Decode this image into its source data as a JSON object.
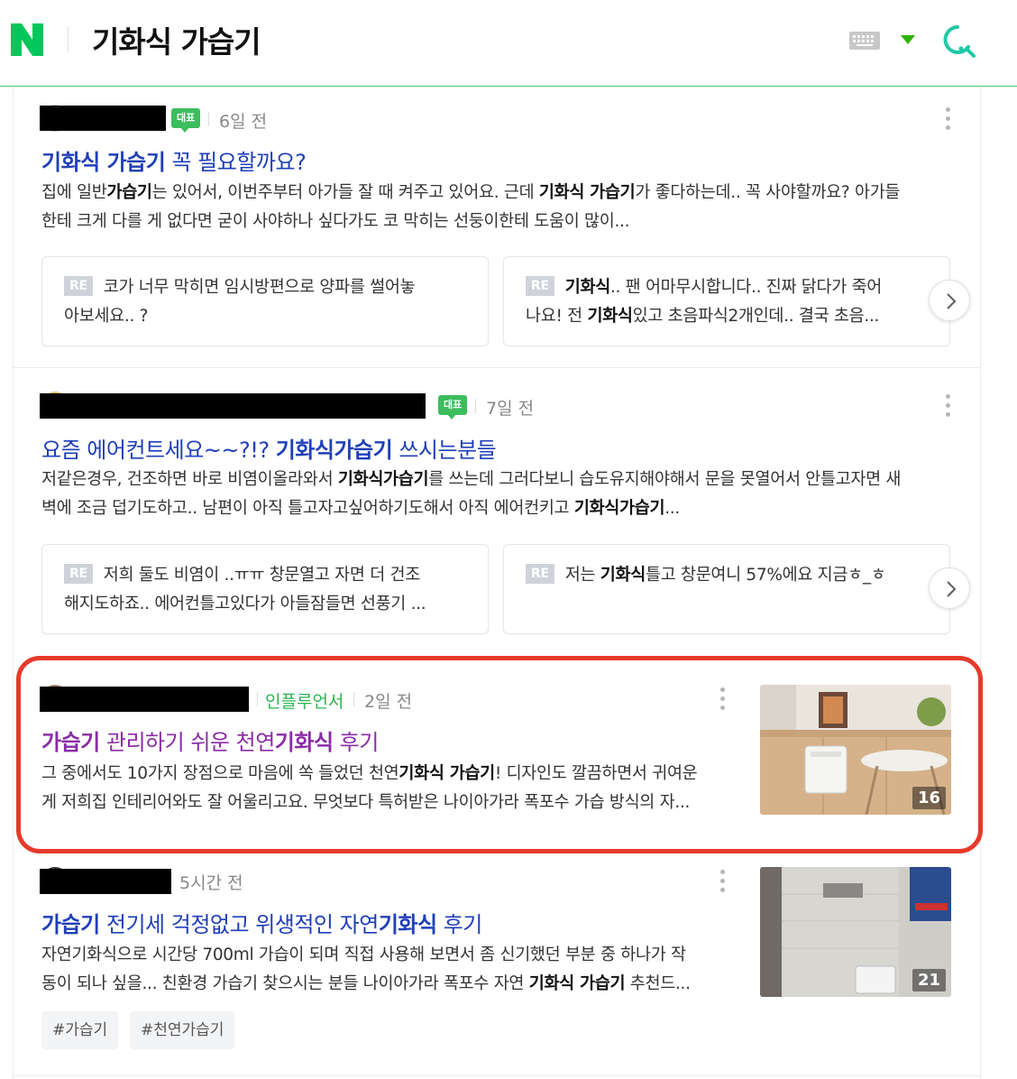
{
  "header": {
    "query": "기화식 가습기",
    "logo_letter": "N",
    "accent_color": "#03c75a",
    "icons": [
      "naver-logo",
      "keyboard-icon",
      "dropdown-arrow-icon",
      "search-icon"
    ]
  },
  "posts": [
    {
      "rep_badge": "대표",
      "time": "6일 전",
      "title_pre": "",
      "title_b1": "기화식 가습기",
      "title_post": " 꼭 필요할까요?",
      "desc_l1_a": "집에 일반",
      "desc_l1_b": "가습기",
      "desc_l1_c": "는 있어서, 이번주부터 아가들 잘 때 켜주고 있어요. 근데 ",
      "desc_l1_d": "기화식 가습기",
      "desc_l1_e": "가 좋다하는데.. 꼭 사야할까요? 아가들",
      "desc_l2": "한테 크게 다를 게 없다면 굳이 사야하나 싶다가도 코 막히는 선둥이한테 도움이 많이...",
      "replies": [
        {
          "re": "RE",
          "pre": "코가 너무 막히면 임시방편으로 양파를 썰어놓",
          "line2": "아보세요.. ?"
        },
        {
          "re": "RE",
          "b1": "기화식",
          "mid": ".. 팬 어마무시합니다.. 진짜 닭다가 죽어",
          "line2_a": "나요! 전 ",
          "line2_b": "기화식",
          "line2_c": "있고 초음파식2개인데.. 결국 초음..."
        }
      ]
    },
    {
      "rep_badge": "대표",
      "time": "7일 전",
      "title_pre": "요즘 에어컨트세요~~?!? ",
      "title_b1": "기화식가습기",
      "title_post": " 쓰시는분들",
      "desc_l1_a": "저같은경우, 건조하면 바로 비염이올라와서 ",
      "desc_l1_b": "기화식가습기",
      "desc_l1_c": "를 쓰는데 그러다보니 습도유지해야해서 문을 못열어서 안틀고자면 새",
      "desc_l2_a": "벽에 조금 덥기도하고.. 남편이 아직 틀고자고싶어하기도해서 아직 에어컨키고 ",
      "desc_l2_b": "기화식가습기",
      "desc_l2_c": "...",
      "replies": [
        {
          "re": "RE",
          "pre": "저희 둘도 비염이 ..ㅠㅠ 창문열고 자면 더 건조",
          "line2": "해지도하죠.. 에어컨틀고있다가 아들잠들면 선풍기 ..."
        },
        {
          "re": "RE",
          "pre": "저는 ",
          "b1": "기화식",
          "post": "틀고 창문여니 57%에요 지금ㅎ_ㅎ"
        }
      ]
    },
    {
      "influencer": "인플루언서",
      "time": "2일 전",
      "title_b1": "가습기",
      "title_mid": " 관리하기 쉬운 천연",
      "title_b2": "기화식",
      "title_post": " 후기",
      "desc_l1_a": "그 중에서도 10가지 장점으로 마음에 쏙 들었던 천연",
      "desc_l1_b": "기화식 가습기",
      "desc_l1_c": "! 디자인도 깔끔하면서 귀여운",
      "desc_l2": "게 저희집 인테리어와도 잘 어울리고요. 무엇보다 특허받은 나이아가라 폭포수 가습 방식의 자...",
      "thumb_count": "16"
    },
    {
      "time": "5시간 전",
      "title_b1": "가습기",
      "title_mid": " 전기세 걱정없고 위생적인 자연",
      "title_b2": "기화식",
      "title_post": " 후기",
      "desc_l1": "자연기화식으로 시간당 700ml 가습이 되며 직접 사용해 보면서 좀 신기했던 부분 중 하나가 작",
      "desc_l2_a": "동이 되나 싶을... 친환경 가습기 찾으시는 분들 나이아가라 폭포수 자연 ",
      "desc_l2_b": "기화식 가습기",
      "desc_l2_c": " 추천드...",
      "thumb_count": "21",
      "tags": [
        "#가습기",
        "#천연가습기"
      ]
    }
  ]
}
